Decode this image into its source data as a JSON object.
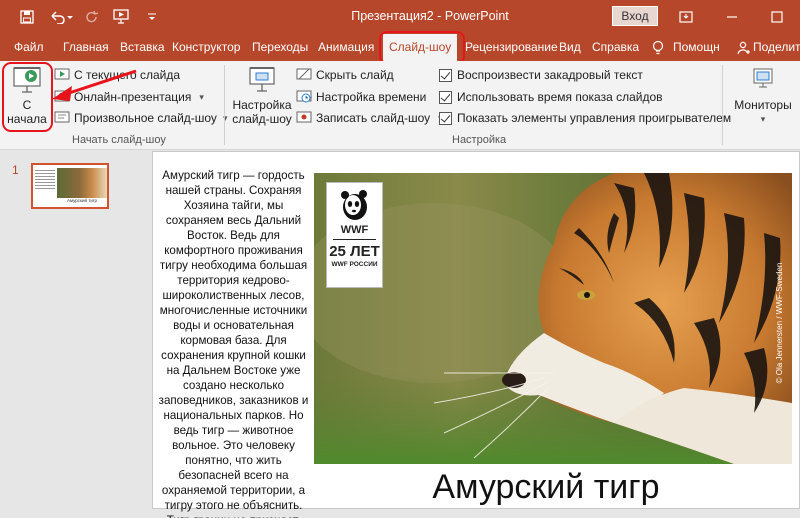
{
  "app": {
    "title": "Презентация2  -  PowerPoint",
    "login_label": "Вход",
    "accent": "#b7472a",
    "highlight": "#e8141b"
  },
  "quick_access": [
    "save-icon",
    "undo-icon",
    "redo-icon",
    "present-icon",
    "customize-icon"
  ],
  "tabs": [
    {
      "label": "Файл"
    },
    {
      "label": "Главная"
    },
    {
      "label": "Вставка"
    },
    {
      "label": "Конструктор"
    },
    {
      "label": "Переходы"
    },
    {
      "label": "Анимация"
    },
    {
      "label": "Слайд-шоу",
      "active": true
    },
    {
      "label": "Рецензирование"
    },
    {
      "label": "Вид"
    },
    {
      "label": "Справка"
    },
    {
      "label": "Помощн"
    },
    {
      "label": "Поделит"
    }
  ],
  "ribbon": {
    "start_group": {
      "from_beginning": "С начала",
      "from_current": "С текущего слайда",
      "online": "Онлайн-презентация",
      "custom": "Произвольное слайд-шоу",
      "label": "Начать слайд-шоу"
    },
    "setup_group": {
      "setup_button": "Настройка слайд-шоу",
      "hide_slide": "Скрыть слайд",
      "rehearse": "Настройка времени",
      "record": "Записать слайд-шоу",
      "play_narrations": "Воспроизвести закадровый текст",
      "use_timings": "Использовать время показа слайдов",
      "show_controls": "Показать элементы управления проигрывателем",
      "label": "Настройка"
    },
    "monitors_group": {
      "label": "Мониторы"
    }
  },
  "thumbnails": [
    {
      "number": "1",
      "caption": "Амурский тигр"
    }
  ],
  "slide": {
    "body_text": "Амурский тигр — гордость нашей страны. Сохраняя Хозяина тайги, мы сохраняем весь Дальний Восток. Ведь для комфортного проживания тигру необходима большая территория кедрово-широколиственных лесов, многочисленные источники воды и основательная кормовая база. Для сохранения крупной кошки на Дальнем Востоке уже создано несколько заповедников, заказников и национальных парков. Но ведь тигр — животное вольное. Это человеку понятно, что жить безопасней всего на охраняемой территории, а тигру этого не объяснить. Тигр границ не признает.",
    "title": "Амурский тигр",
    "logo": {
      "brand": "WWF",
      "years": "25 ЛЕТ",
      "sub": "WWF РОССИИ"
    },
    "photo_credit": "© Ola Jennersten / WWF-Sweden"
  }
}
